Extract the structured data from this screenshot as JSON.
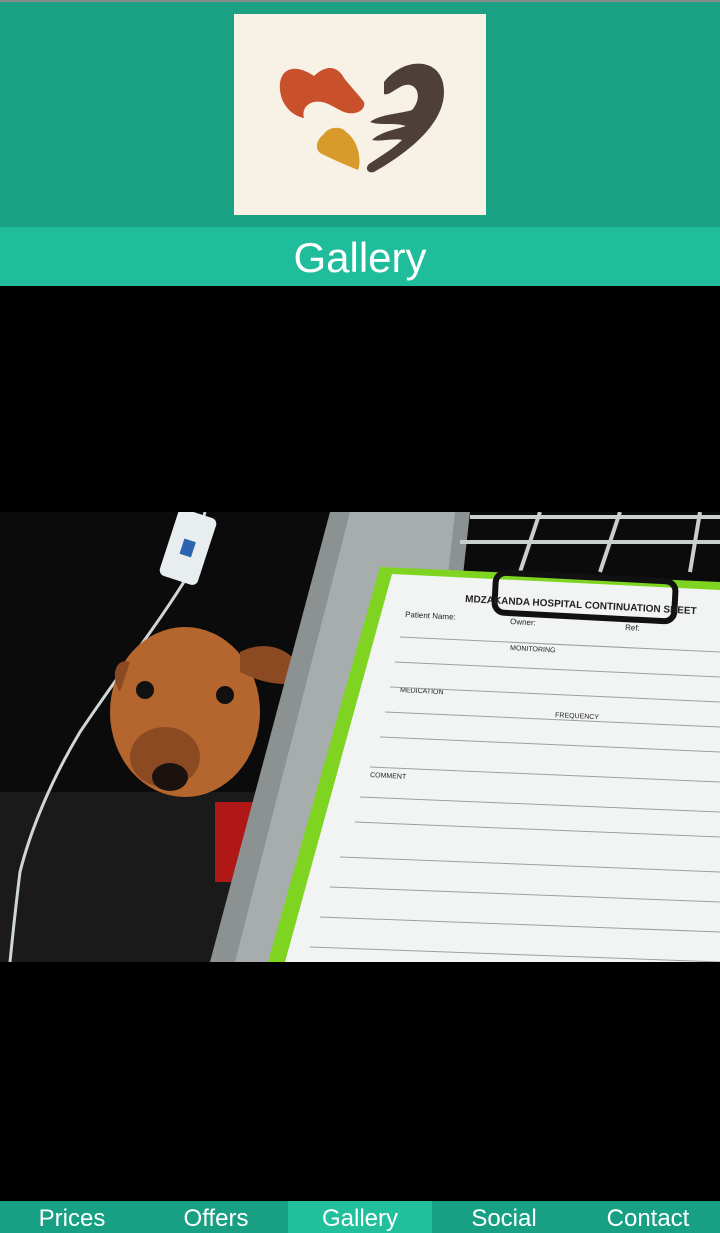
{
  "header": {
    "logo_icon": "pet-care-heart-logo"
  },
  "page": {
    "title": "Gallery"
  },
  "gallery": {
    "photo_icon": "dog-with-iv-drip-photo",
    "clipboard": {
      "heading": "MDZAKANDA HOSPITAL CONTINUATION SHEET",
      "patient_label": "Patient Name:",
      "owner_label": "Owner:",
      "ref_label": "Ref:",
      "monitoring": "MONITORING",
      "medication": "MEDICATION",
      "frequency": "FREQUENCY",
      "comment": "COMMENT"
    }
  },
  "nav": {
    "items": [
      {
        "label": "Prices"
      },
      {
        "label": "Offers"
      },
      {
        "label": "Gallery"
      },
      {
        "label": "Social"
      },
      {
        "label": "Contact"
      }
    ],
    "active_index": 2
  },
  "colors": {
    "header_bg": "#1aa184",
    "title_bg": "#1fbd9b",
    "nav_bg": "#18a085",
    "nav_active_bg": "#21bf9c"
  }
}
